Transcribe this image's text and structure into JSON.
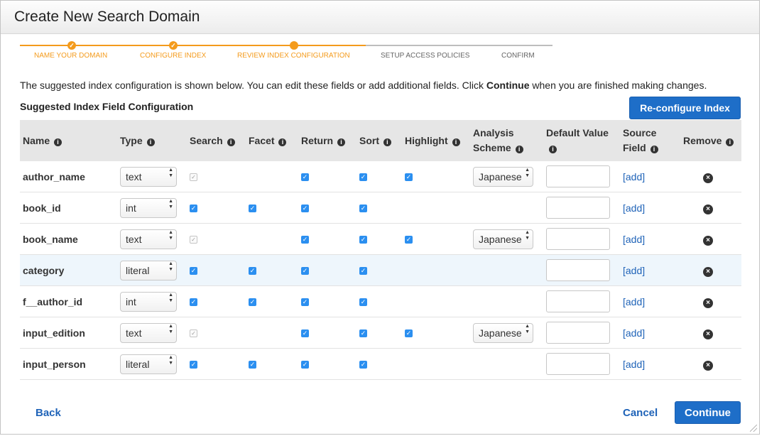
{
  "dialog": {
    "title": "Create New Search Domain"
  },
  "wizard": {
    "steps": [
      {
        "label": "NAME YOUR DOMAIN",
        "state": "done"
      },
      {
        "label": "CONFIGURE INDEX",
        "state": "done"
      },
      {
        "label": "REVIEW INDEX CONFIGURATION",
        "state": "current"
      },
      {
        "label": "SETUP ACCESS POLICIES",
        "state": "todo"
      },
      {
        "label": "CONFIRM",
        "state": "todo"
      }
    ]
  },
  "intro": {
    "before": "The suggested index configuration is shown below. You can edit these fields or add additional fields. Click ",
    "bold": "Continue",
    "after": " when you are finished making changes."
  },
  "section_title": "Suggested Index Field Configuration",
  "reconfigure_label": "Re-configure Index",
  "table": {
    "headers": {
      "name": "Name",
      "type": "Type",
      "search": "Search",
      "facet": "Facet",
      "return": "Return",
      "sort": "Sort",
      "highlight": "Highlight",
      "analysis_1": "Analysis",
      "analysis_2": "Scheme",
      "default_1": "Default Value",
      "source_1": "Source",
      "source_2": "Field",
      "remove": "Remove"
    },
    "rows": [
      {
        "name": "author_name",
        "type": "text",
        "search": "disabled",
        "facet": "none",
        "return": "checked",
        "sort": "checked",
        "highlight": "checked",
        "analysis": "Japanese",
        "add": "[add]"
      },
      {
        "name": "book_id",
        "type": "int",
        "search": "checked",
        "facet": "checked",
        "return": "checked",
        "sort": "checked",
        "highlight": "none",
        "analysis": "",
        "add": "[add]"
      },
      {
        "name": "book_name",
        "type": "text",
        "search": "disabled",
        "facet": "none",
        "return": "checked",
        "sort": "checked",
        "highlight": "checked",
        "analysis": "Japanese",
        "add": "[add]"
      },
      {
        "name": "category",
        "type": "literal",
        "search": "checked",
        "facet": "checked",
        "return": "checked",
        "sort": "checked",
        "highlight": "none",
        "analysis": "",
        "add": "[add]",
        "highlighted": true
      },
      {
        "name": "f__author_id",
        "type": "int",
        "search": "checked",
        "facet": "checked",
        "return": "checked",
        "sort": "checked",
        "highlight": "none",
        "analysis": "",
        "add": "[add]"
      },
      {
        "name": "input_edition",
        "type": "text",
        "search": "disabled",
        "facet": "none",
        "return": "checked",
        "sort": "checked",
        "highlight": "checked",
        "analysis": "Japanese",
        "add": "[add]"
      },
      {
        "name": "input_person",
        "type": "literal",
        "search": "checked",
        "facet": "checked",
        "return": "checked",
        "sort": "checked",
        "highlight": "none",
        "analysis": "",
        "add": "[add]"
      }
    ]
  },
  "footer": {
    "back": "Back",
    "cancel": "Cancel",
    "continue": "Continue"
  },
  "colors": {
    "accent": "#f49b1c",
    "primary_button": "#1e6ec8",
    "link": "#1f63b8",
    "checkbox": "#2b8ff0"
  },
  "icons": {
    "info": "info-circle-icon",
    "remove": "remove-circle-x-icon",
    "step_done": "check-icon"
  }
}
